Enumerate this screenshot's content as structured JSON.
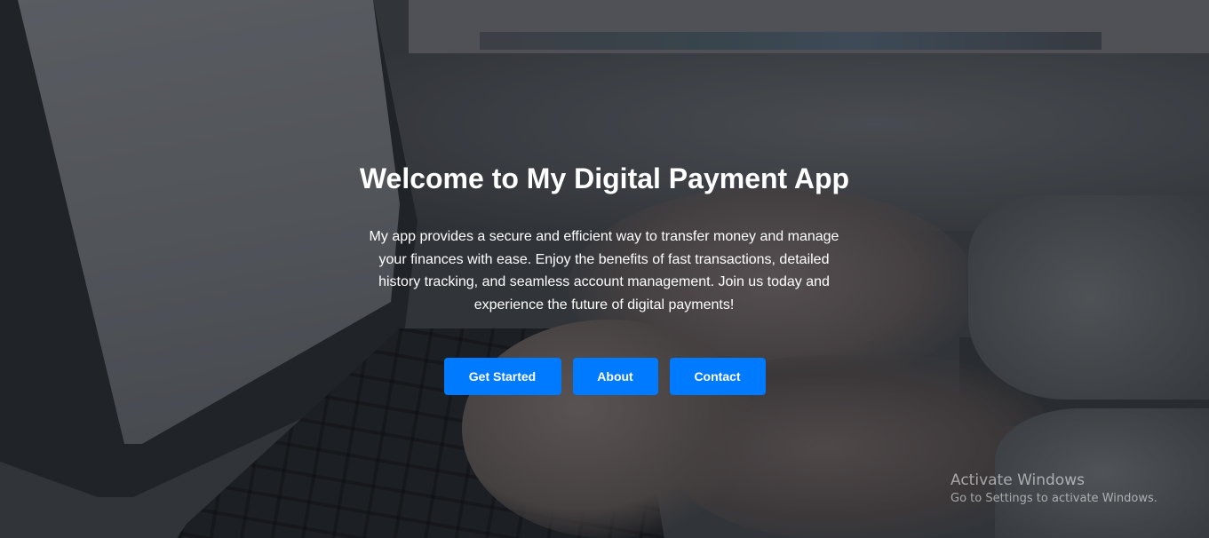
{
  "hero": {
    "title": "Welcome to My Digital Payment App",
    "description": "My app provides a secure and efficient way to transfer money and manage your finances with ease. Enjoy the benefits of fast transactions, detailed history tracking, and seamless account management. Join us today and experience the future of digital payments!",
    "buttons": {
      "get_started": "Get Started",
      "about": "About",
      "contact": "Contact"
    }
  },
  "os_watermark": {
    "title": "Activate Windows",
    "subtitle": "Go to Settings to activate Windows."
  },
  "colors": {
    "button_background": "#007bff",
    "text": "#ffffff"
  }
}
